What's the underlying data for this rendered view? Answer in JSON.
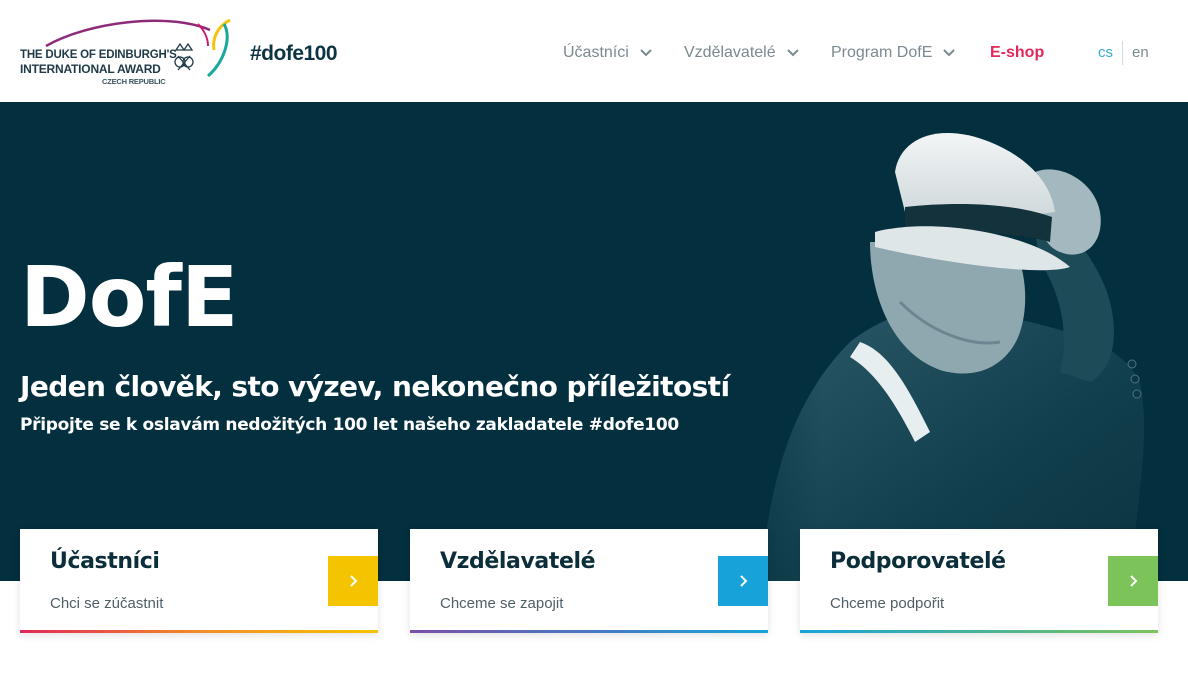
{
  "header": {
    "logo": {
      "line1": "THE DUKE OF EDINBURGH'S",
      "line2": "INTERNATIONAL AWARD",
      "line3": "CZECH REPUBLIC",
      "icon": "dofe-crest-icon"
    },
    "hashtag": "#dofe100",
    "nav": [
      {
        "label": "Účastníci",
        "has_dropdown": true
      },
      {
        "label": "Vzdělavatelé",
        "has_dropdown": true
      },
      {
        "label": "Program DofE",
        "has_dropdown": true
      },
      {
        "label": "E-shop",
        "has_dropdown": false
      }
    ],
    "languages": {
      "cs": "cs",
      "en": "en",
      "active": "cs"
    }
  },
  "hero": {
    "title": "DofE",
    "subtitle": "Jeden člověk, sto výzev, nekonečno příležitostí",
    "tagline": "Připojte se k oslavám nedožitých 100 let našeho zakladatele #dofe100",
    "background_color": "#032f3e"
  },
  "cards": [
    {
      "title": "Účastníci",
      "desc": "Chci se zúčastnit",
      "button_color": "#f5c400",
      "icon": "chevron-right-icon"
    },
    {
      "title": "Vzdělavatelé",
      "desc": "Chceme se zapojit",
      "button_color": "#17a3d9",
      "icon": "chevron-right-icon"
    },
    {
      "title": "Podporovatelé",
      "desc": "Chceme podpořit",
      "button_color": "#7cc35a",
      "icon": "chevron-right-icon"
    }
  ],
  "colors": {
    "accent_red": "#e2275b",
    "accent_blue": "#38a8d6",
    "nav_gray": "#7a8a90"
  }
}
